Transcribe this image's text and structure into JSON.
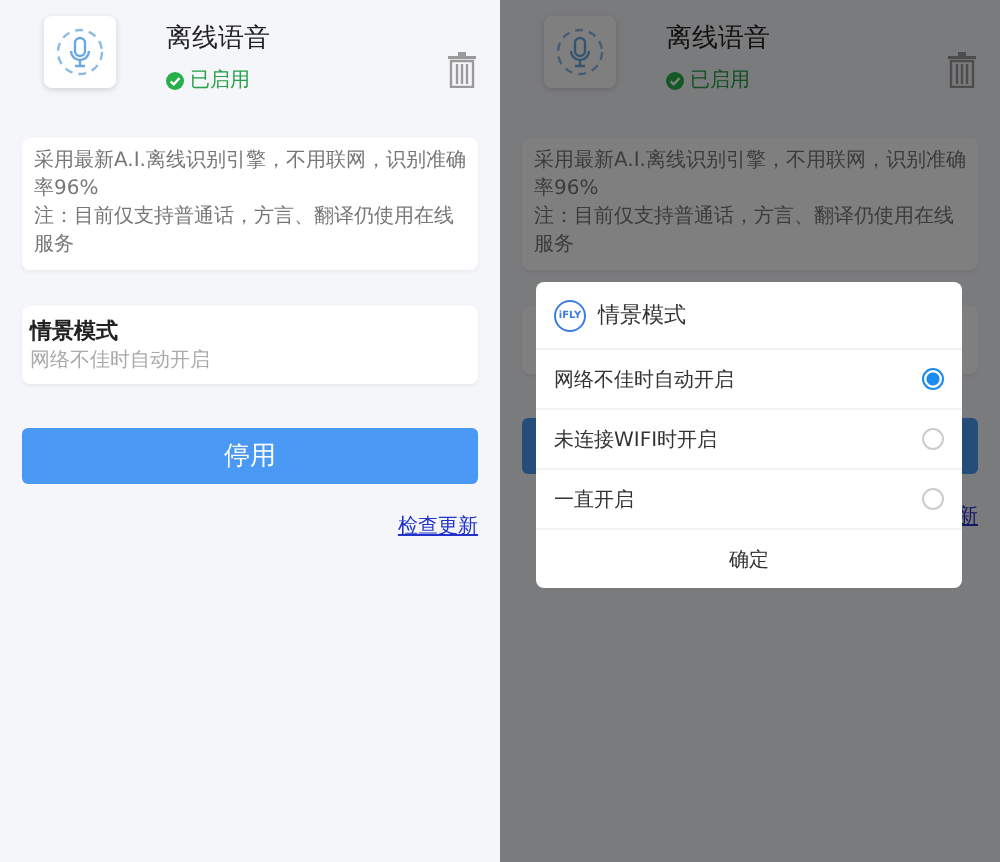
{
  "main_screen": {
    "title": "离线语音",
    "status": "已启用",
    "info_lines": [
      "采用最新A.I.离线识别引擎，不用联网，识别准确率96%",
      "注：目前仅支持普通话，方言、翻译仍使用在线服务"
    ],
    "scene_card": {
      "title": "情景模式",
      "subtitle": "网络不佳时自动开启"
    },
    "button": "停用",
    "link": "检查更新"
  },
  "dimmed_screen": {
    "title": "离线语音",
    "status": "已启用",
    "info_lines": [
      "采用最新A.I.离线识别引擎，不用联网，识别准确率96%",
      "注：目前仅支持普通话，方言、翻译仍使用在线服务"
    ],
    "link": "新"
  },
  "dialog": {
    "logo": "iFLY",
    "title": "情景模式",
    "options": [
      {
        "label": "网络不佳时自动开启",
        "selected": true
      },
      {
        "label": "未连接WIFI时开启",
        "selected": false
      },
      {
        "label": "一直开启",
        "selected": false
      }
    ],
    "confirm": "确定"
  }
}
